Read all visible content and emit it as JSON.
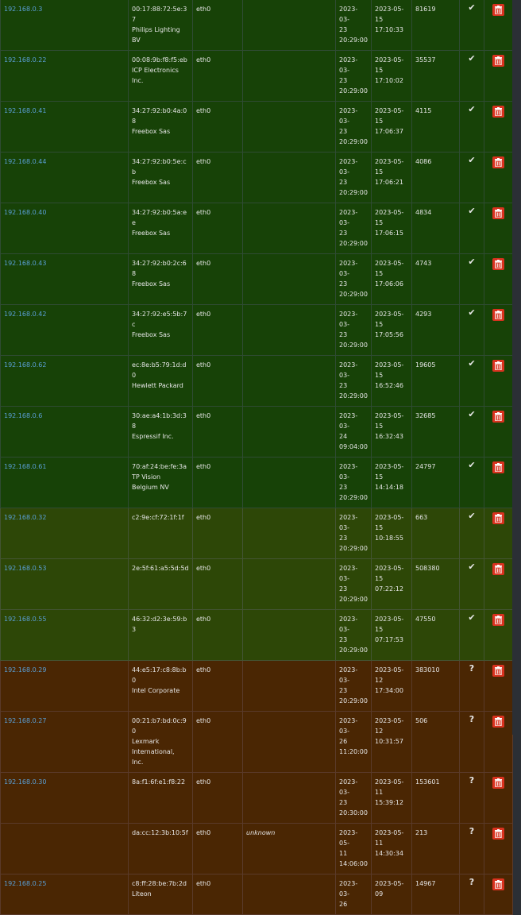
{
  "colors": {
    "online_fresh": "#174207",
    "online_recent": "#2d4707",
    "stale": "#4a2603",
    "link": "#5a9fd6",
    "delete": "#d9321f"
  },
  "rows": [
    {
      "ip": "192.168.0.3",
      "mac": "00:17:88:72:5e:37",
      "vendor": "Philips Lighting BV",
      "iface": "eth0",
      "note": "",
      "first": [
        "2023-03-",
        "23",
        "20:29:00"
      ],
      "last": [
        "2023-05-",
        "15",
        "17:10:33"
      ],
      "count": "81619",
      "status": "check-icon",
      "status_text": "✔",
      "tone": "g1",
      "vendor_lines": [
        "Philips Lighting",
        "BV"
      ]
    },
    {
      "ip": "192.168.0.22",
      "mac": "00:08:9b:f8:f5:eb",
      "vendor": "ICP Electronics Inc.",
      "iface": "eth0",
      "note": "",
      "first": [
        "2023-03-",
        "23",
        "20:29:00"
      ],
      "last": [
        "2023-05-",
        "15",
        "17:10:02"
      ],
      "count": "35537",
      "status": "check-icon",
      "status_text": "✔",
      "tone": "g1",
      "vendor_lines": [
        "ICP Electronics",
        "Inc."
      ]
    },
    {
      "ip": "192.168.0.41",
      "mac": "34:27:92:b0:4a:08",
      "vendor": "Freebox Sas",
      "iface": "eth0",
      "note": "",
      "first": [
        "2023-03-",
        "23",
        "20:29:00"
      ],
      "last": [
        "2023-05-",
        "15",
        "17:06:37"
      ],
      "count": "4115",
      "status": "check-icon",
      "status_text": "✔",
      "tone": "g1",
      "vendor_lines": [
        "Freebox Sas"
      ]
    },
    {
      "ip": "192.168.0.44",
      "mac": "34:27:92:b0:5e:cb",
      "vendor": "Freebox Sas",
      "iface": "eth0",
      "note": "",
      "first": [
        "2023-03-",
        "23",
        "20:29:00"
      ],
      "last": [
        "2023-05-",
        "15",
        "17:06:21"
      ],
      "count": "4086",
      "status": "check-icon",
      "status_text": "✔",
      "tone": "g1",
      "vendor_lines": [
        "Freebox Sas"
      ]
    },
    {
      "ip": "192.168.0.40",
      "mac": "34:27:92:b0:5a:ee",
      "vendor": "Freebox Sas",
      "iface": "eth0",
      "note": "",
      "first": [
        "2023-03-",
        "23",
        "20:29:00"
      ],
      "last": [
        "2023-05-",
        "15",
        "17:06:15"
      ],
      "count": "4834",
      "status": "check-icon",
      "status_text": "✔",
      "tone": "g1",
      "vendor_lines": [
        "Freebox Sas"
      ]
    },
    {
      "ip": "192.168.0.43",
      "mac": "34:27:92:b0:2c:68",
      "vendor": "Freebox Sas",
      "iface": "eth0",
      "note": "",
      "first": [
        "2023-03-",
        "23",
        "20:29:00"
      ],
      "last": [
        "2023-05-",
        "15",
        "17:06:06"
      ],
      "count": "4743",
      "status": "check-icon",
      "status_text": "✔",
      "tone": "g1",
      "vendor_lines": [
        "Freebox Sas"
      ]
    },
    {
      "ip": "192.168.0.42",
      "mac": "34:27:92:e5:5b:7c",
      "vendor": "Freebox Sas",
      "iface": "eth0",
      "note": "",
      "first": [
        "2023-03-",
        "23",
        "20:29:00"
      ],
      "last": [
        "2023-05-",
        "15",
        "17:05:56"
      ],
      "count": "4293",
      "status": "check-icon",
      "status_text": "✔",
      "tone": "g1",
      "vendor_lines": [
        "Freebox Sas"
      ]
    },
    {
      "ip": "192.168.0.62",
      "mac": "ec:8e:b5:79:1d:d0",
      "vendor": "Hewlett Packard",
      "iface": "eth0",
      "note": "",
      "first": [
        "2023-03-",
        "23",
        "20:29:00"
      ],
      "last": [
        "2023-05-",
        "15",
        "16:52:46"
      ],
      "count": "19605",
      "status": "check-icon",
      "status_text": "✔",
      "tone": "g1",
      "vendor_lines": [
        "Hewlett Packard"
      ]
    },
    {
      "ip": "192.168.0.6",
      "mac": "30:ae:a4:1b:3d:38",
      "vendor": "Espressif Inc.",
      "iface": "eth0",
      "note": "",
      "first": [
        "2023-03-",
        "24",
        "09:04:00"
      ],
      "last": [
        "2023-05-",
        "15",
        "16:32:43"
      ],
      "count": "32685",
      "status": "check-icon",
      "status_text": "✔",
      "tone": "g1",
      "vendor_lines": [
        "Espressif Inc."
      ]
    },
    {
      "ip": "192.168.0.61",
      "mac": "70:af:24:be:fe:3a",
      "vendor": "TP Vision Belgium NV",
      "iface": "eth0",
      "note": "",
      "first": [
        "2023-03-",
        "23",
        "20:29:00"
      ],
      "last": [
        "2023-05-",
        "15",
        "14:14:18"
      ],
      "count": "24797",
      "status": "check-icon",
      "status_text": "✔",
      "tone": "g1",
      "vendor_lines": [
        "TP Vision",
        "Belgium NV"
      ]
    },
    {
      "ip": "192.168.0.32",
      "mac": "c2:9e:cf:72:1f:1f",
      "vendor": "",
      "iface": "eth0",
      "note": "",
      "first": [
        "2023-03-",
        "23",
        "20:29:00"
      ],
      "last": [
        "2023-05-",
        "15",
        "10:18:55"
      ],
      "count": "663",
      "status": "check-icon",
      "status_text": "✔",
      "tone": "g2",
      "vendor_lines": []
    },
    {
      "ip": "192.168.0.53",
      "mac": "2e:5f:61:a5:5d:5d",
      "vendor": "",
      "iface": "eth0",
      "note": "",
      "first": [
        "2023-03-",
        "23",
        "20:29:00"
      ],
      "last": [
        "2023-05-",
        "15",
        "07:22:12"
      ],
      "count": "508380",
      "status": "check-icon",
      "status_text": "✔",
      "tone": "g2",
      "vendor_lines": []
    },
    {
      "ip": "192.168.0.55",
      "mac": "46:32:d2:3e:59:b3",
      "vendor": "",
      "iface": "eth0",
      "note": "",
      "first": [
        "2023-03-",
        "23",
        "20:29:00"
      ],
      "last": [
        "2023-05-",
        "15",
        "07:17:53"
      ],
      "count": "47550",
      "status": "check-icon",
      "status_text": "✔",
      "tone": "g2",
      "vendor_lines": []
    },
    {
      "ip": "192.168.0.29",
      "mac": "44:e5:17:c8:8b:b0",
      "vendor": "Intel Corporate",
      "iface": "eth0",
      "note": "",
      "first": [
        "2023-03-",
        "23",
        "20:29:00"
      ],
      "last": [
        "2023-05-",
        "12",
        "17:34:00"
      ],
      "count": "383010",
      "status": "question-icon",
      "status_text": "?",
      "tone": "br",
      "vendor_lines": [
        "Intel Corporate"
      ]
    },
    {
      "ip": "192.168.0.27",
      "mac": "00:21:b7:bd:0c:90",
      "vendor": "Lexmark International, Inc.",
      "iface": "eth0",
      "note": "",
      "first": [
        "2023-03-",
        "26",
        "11:20:00"
      ],
      "last": [
        "2023-05-",
        "12",
        "10:31:57"
      ],
      "count": "506",
      "status": "question-icon",
      "status_text": "?",
      "tone": "br",
      "vendor_lines": [
        "Lexmark",
        "International,",
        "Inc."
      ]
    },
    {
      "ip": "192.168.0.30",
      "mac": "8a:f1:6f:e1:f8:22",
      "vendor": "",
      "iface": "eth0",
      "note": "",
      "first": [
        "2023-03-",
        "23",
        "20:30:00"
      ],
      "last": [
        "2023-05-",
        "11",
        "15:39:12"
      ],
      "count": "153601",
      "status": "question-icon",
      "status_text": "?",
      "tone": "br",
      "vendor_lines": []
    },
    {
      "ip": "",
      "mac": "da:cc:12:3b:10:5f",
      "vendor": "",
      "iface": "eth0",
      "note": "unknown",
      "first": [
        "2023-05-",
        "11",
        "14:06:00"
      ],
      "last": [
        "2023-05-",
        "11",
        "14:30:34"
      ],
      "count": "213",
      "status": "question-icon",
      "status_text": "?",
      "tone": "br",
      "vendor_lines": []
    },
    {
      "ip": "192.168.0.25",
      "mac": "c8:ff:28:be:7b:2d",
      "vendor": "Liteon",
      "iface": "eth0",
      "note": "",
      "first": [
        "2023-03-",
        "26",
        ""
      ],
      "last": [
        "2023-05-",
        "09",
        ""
      ],
      "count": "14967",
      "status": "question-icon",
      "status_text": "?",
      "tone": "br",
      "vendor_lines": [
        "Liteon"
      ]
    }
  ]
}
